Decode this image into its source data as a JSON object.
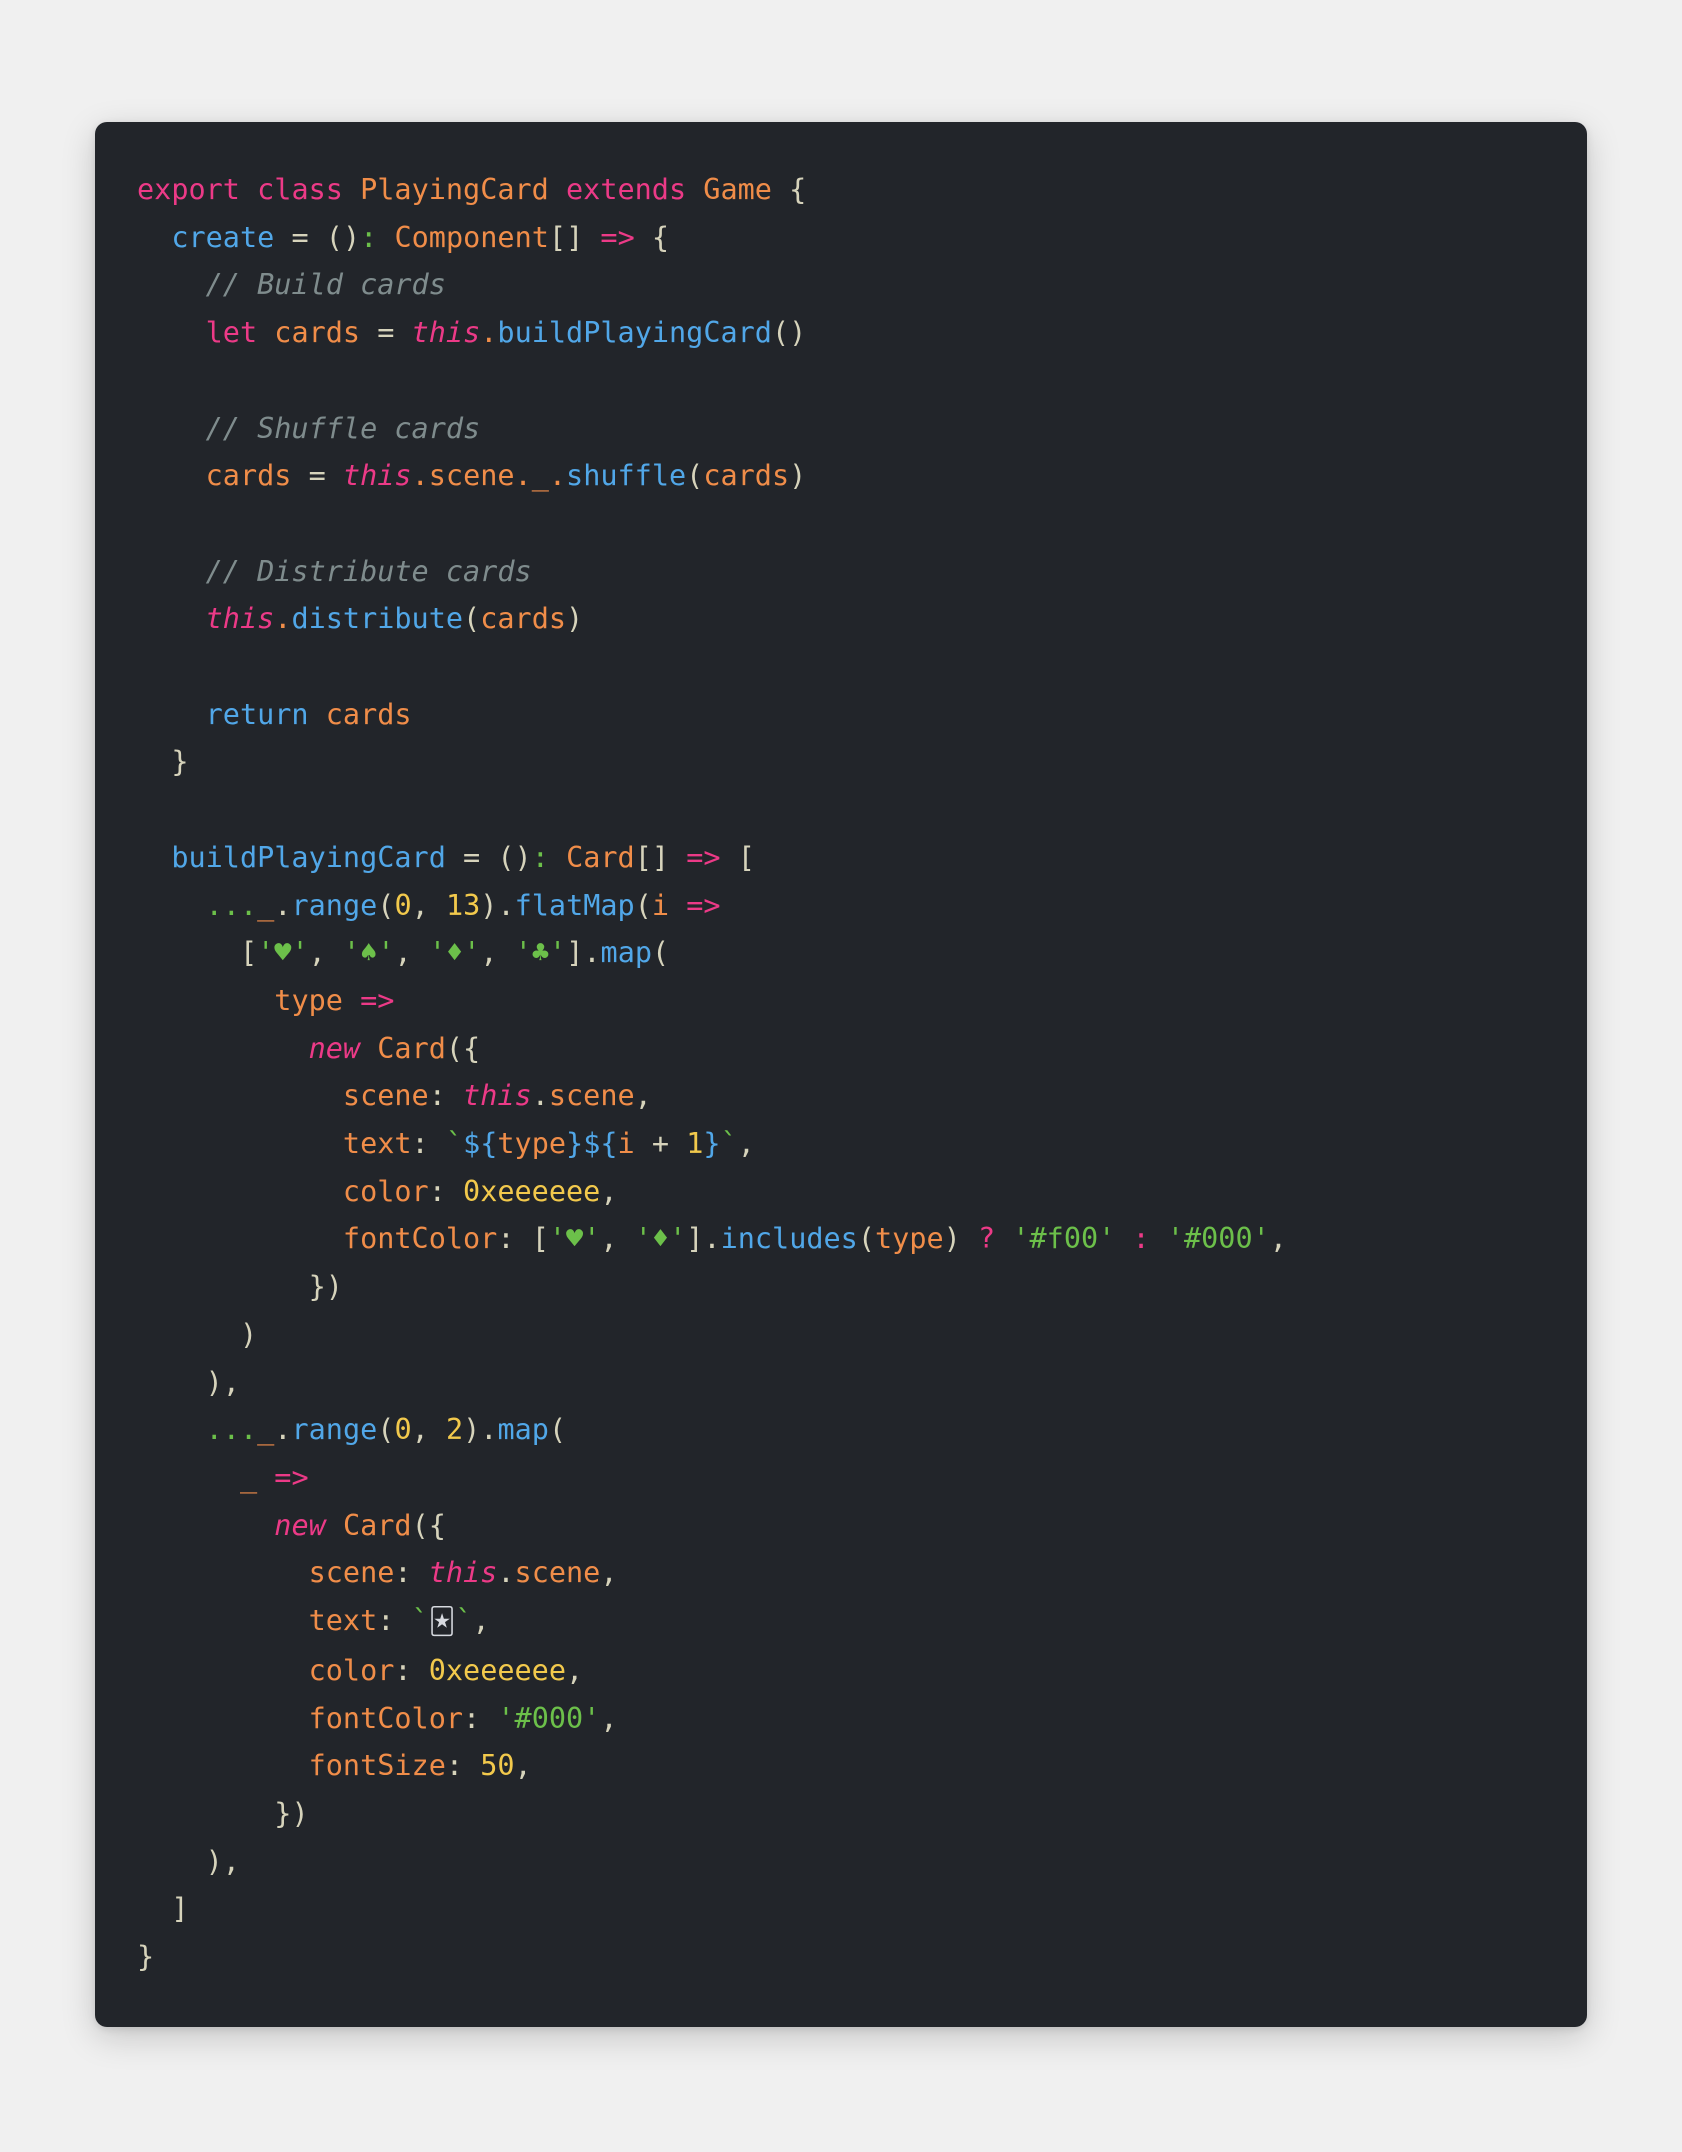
{
  "window": {
    "background_color": "#f0f0f0",
    "card_background": "#22252a",
    "default_text_color": "#d7dae0"
  },
  "palette": {
    "keyword": "#ec3a87",
    "function": "#51a7e8",
    "identifier": "#f08d49",
    "punctuation": "#d6d3bb",
    "number": "#f2c94c",
    "string": "#6cc04a",
    "comment": "#7f8c8d"
  },
  "code": {
    "language": "typescript",
    "lines": [
      "export class PlayingCard extends Game {",
      "  create = (): Component[] => {",
      "    // Build cards",
      "    let cards = this.buildPlayingCard()",
      "",
      "    // Shuffle cards",
      "    cards = this.scene._.shuffle(cards)",
      "",
      "    // Distribute cards",
      "    this.distribute(cards)",
      "",
      "    return cards",
      "  }",
      "",
      "  buildPlayingCard = (): Card[] => [",
      "    ..._.range(0, 13).flatMap(i =>",
      "      ['♥', '♠', '♦', '♣'].map(",
      "        type =>",
      "          new Card({",
      "            scene: this.scene,",
      "            text: `${type}${i + 1}`,",
      "            color: 0xeeeeee,",
      "            fontColor: ['♥', '♦'].includes(type) ? '#f00' : '#000',",
      "          })",
      "      )",
      "    ),",
      "    ..._.range(0, 2).map(",
      "      _ =>",
      "        new Card({",
      "          scene: this.scene,",
      "          text: `🃏`,",
      "          color: 0xeeeeee,",
      "          fontColor: '#000',",
      "          fontSize: 50,",
      "        })",
      "    ),",
      "  ]",
      "}"
    ],
    "tokens": {
      "keywords": [
        "export",
        "class",
        "extends",
        "let",
        "return",
        "new",
        "this"
      ],
      "class_names": [
        "PlayingCard",
        "Game",
        "Component",
        "Card"
      ],
      "methods": [
        "create",
        "buildPlayingCard",
        "shuffle",
        "distribute",
        "range",
        "flatMap",
        "map",
        "includes"
      ],
      "properties": [
        "scene",
        "text",
        "color",
        "fontColor",
        "fontSize"
      ],
      "numbers": [
        "0",
        "13",
        "1",
        "2",
        "50",
        "0xeeeeee"
      ],
      "strings": [
        "'♥'",
        "'♠'",
        "'♦'",
        "'♣'",
        "'#f00'",
        "'#000'"
      ],
      "comments": [
        "// Build cards",
        "// Shuffle cards",
        "// Distribute cards"
      ],
      "suits": [
        "♥",
        "♠",
        "♦",
        "♣"
      ],
      "joker_emoji": "🃏"
    }
  }
}
